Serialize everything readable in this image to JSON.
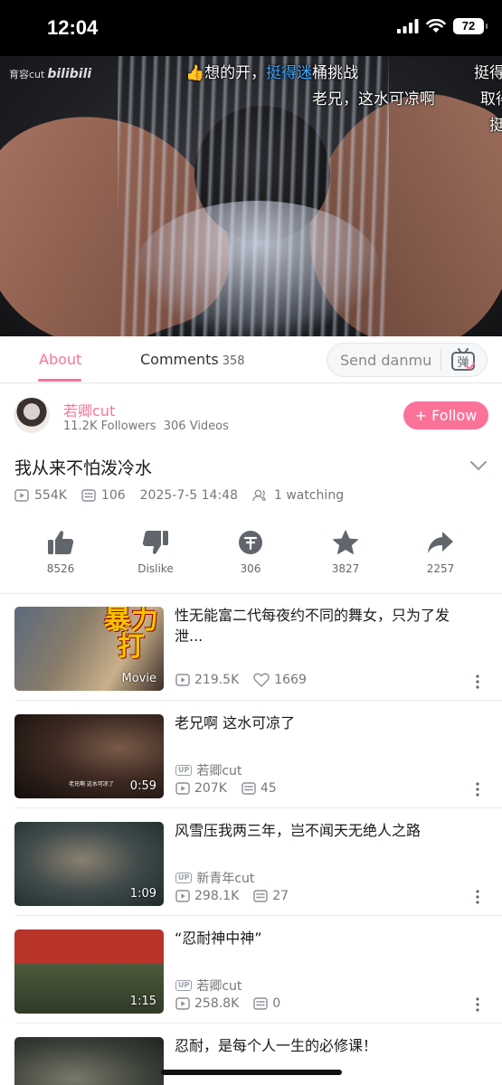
{
  "status_bar": {
    "time": "12:04",
    "battery": "72"
  },
  "video": {
    "watermark_prefix": "育容cut",
    "watermark_logo": "bilibili",
    "danmu": [
      {
        "prefix": "👍想的开，",
        "highlight": "挺得迷",
        "suffix": "桶挑战"
      },
      {
        "text": "老兄，这水可凉啊"
      },
      {
        "text": "挺得"
      },
      {
        "text": "取得"
      },
      {
        "text": "挺"
      }
    ]
  },
  "tabs": {
    "about": "About",
    "comments": "Comments",
    "comments_count": "358",
    "danmu_placeholder": "Send danmu",
    "danmu_icon_char": "弹"
  },
  "uploader": {
    "name": "若卿cut",
    "followers": "11.2K Followers",
    "videos": "306 Videos",
    "follow_label": "+ Follow"
  },
  "video_info": {
    "title": "我从来不怕泼冷水",
    "views": "554K",
    "danmaku": "106",
    "date": "2025-7-5 14:48",
    "watching": "1 watching"
  },
  "actions": {
    "like": "8526",
    "dislike": "Dislike",
    "coin": "306",
    "favorite": "3827",
    "share": "2257"
  },
  "related": [
    {
      "title": "性无能富二代每夜约不同的舞女，只为了发泄...",
      "badge": "Movie",
      "big_text": "暴力打",
      "views": "219.5K",
      "likes": "1669"
    },
    {
      "title": "老兄啊 这水可凉了",
      "duration": "0:59",
      "uploader": "若卿cut",
      "views": "207K",
      "danmaku": "45",
      "sub": "老兄啊 这水可凉了"
    },
    {
      "title": "风雪压我两三年，岂不闻天无绝人之路",
      "duration": "1:09",
      "uploader": "新青年cut",
      "views": "298.1K",
      "danmaku": "27"
    },
    {
      "title": "“忍耐神中神”",
      "duration": "1:15",
      "uploader": "若卿cut",
      "views": "258.8K",
      "danmaku": "0"
    },
    {
      "title": "忍耐，是每个人一生的必修课！"
    }
  ],
  "colors": {
    "accent": "#fb7299",
    "text": "#18191c",
    "muted": "#777777"
  }
}
